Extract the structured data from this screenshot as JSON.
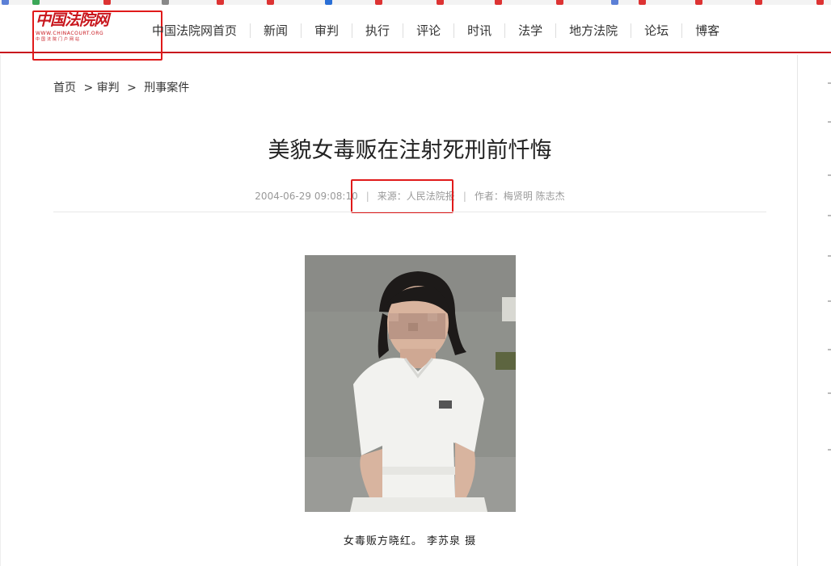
{
  "logo": {
    "name_cn": "中国法院网",
    "url_text": "WWW.CHINACOURT.ORG",
    "slogan": "中国法院门户网站"
  },
  "nav": {
    "items": [
      "中国法院网首页",
      "新闻",
      "审判",
      "执行",
      "评论",
      "时讯",
      "法学",
      "地方法院",
      "论坛",
      "博客"
    ]
  },
  "breadcrumb": {
    "home": "首页",
    "sep": ">",
    "level1": "审判",
    "level2": "刑事案件"
  },
  "article": {
    "title": "美貌女毒贩在注射死刑前忏悔",
    "datetime": "2004-06-29 09:08:10",
    "separator": "|",
    "source": "来源：人民法院报",
    "author": "作者：梅贤明 陈志杰",
    "image_caption": "女毒贩方晓红。 李苏泉 摄"
  },
  "colors": {
    "brand_red": "#c8161d",
    "highlight_red": "#e01a1a"
  }
}
